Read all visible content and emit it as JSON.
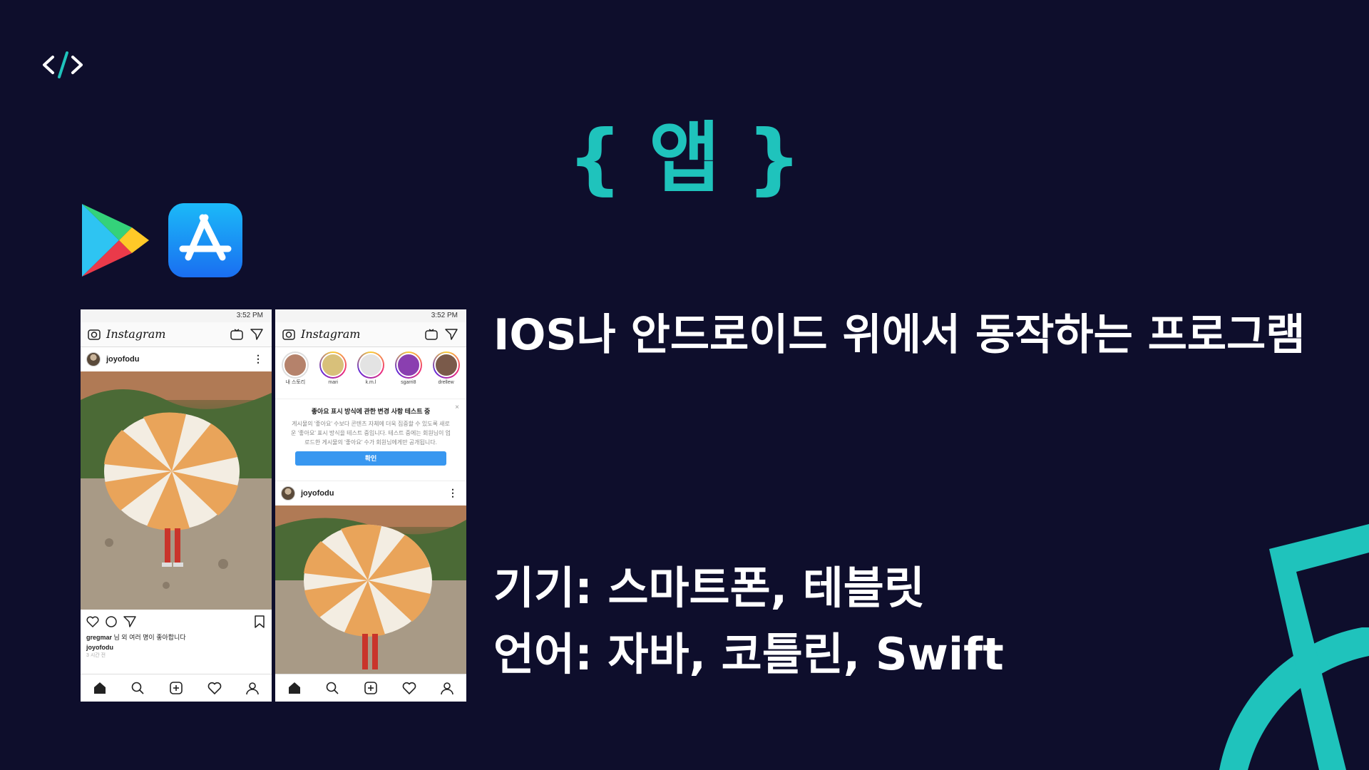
{
  "slide": {
    "title": "{ 앱 }",
    "description": "IOS나 안드로이드 위에서 동작하는 프로그램",
    "devices": "기기: 스마트폰, 테블릿",
    "languages": "언어: 자바, 코틀린, Swift"
  },
  "colors": {
    "background": "#0e0e2c",
    "accent": "#1fc3bc",
    "text": "#ffffff"
  },
  "icons": [
    "code-icon",
    "google-play-icon",
    "app-store-icon"
  ],
  "phone_left": {
    "status_time": "3:52 PM",
    "app_logo": "Instagram",
    "username": "joyofodu",
    "likes_user": "gregmar",
    "likes_text": "님 외 여러 명이 좋아합니다",
    "caption_user": "joyofodu",
    "time_ago": "3 시간 전"
  },
  "phone_right": {
    "status_time": "3:52 PM",
    "app_logo": "Instagram",
    "stories": [
      {
        "label": "내 스토리"
      },
      {
        "label": "mari"
      },
      {
        "label": "k.m.l"
      },
      {
        "label": "sgarri8"
      },
      {
        "label": "drellew"
      }
    ],
    "notice": {
      "title": "좋아요 표시 방식에 관한 변경 사항 테스트 중",
      "body": "게시물의 '좋아요' 수보다 콘텐츠 자체에 더욱 집중할 수 있도록 새로운 '좋아요' 표시 방식을 테스트 중입니다. 테스트 중에는 회원님이 업로드한 게시물의 '좋아요' 수가 회원님에게만 공개됩니다.",
      "button": "확인",
      "close": "×"
    },
    "username": "joyofodu"
  }
}
